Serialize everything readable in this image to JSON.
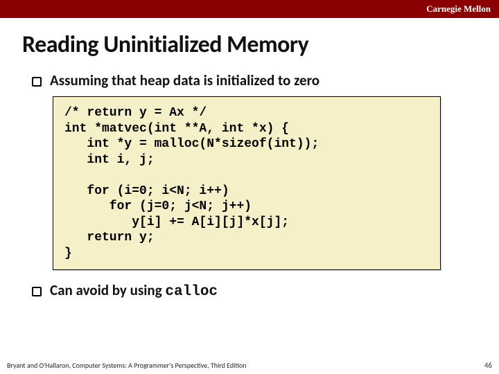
{
  "header": {
    "brand": "Carnegie Mellon"
  },
  "title": "Reading Uninitialized Memory",
  "bullets": {
    "b0": "Assuming that heap data is initialized to zero",
    "b1_prefix": "Can avoid by using ",
    "b1_code": "calloc"
  },
  "code": "/* return y = Ax */\nint *matvec(int **A, int *x) {\n   int *y = malloc(N*sizeof(int));\n   int i, j;\n\n   for (i=0; i<N; i++)\n      for (j=0; j<N; j++)\n         y[i] += A[i][j]*x[j];\n   return y;\n}",
  "footer": {
    "attribution": "Bryant and O'Hallaron, Computer Systems: A Programmer's Perspective, Third Edition",
    "page": "46"
  }
}
